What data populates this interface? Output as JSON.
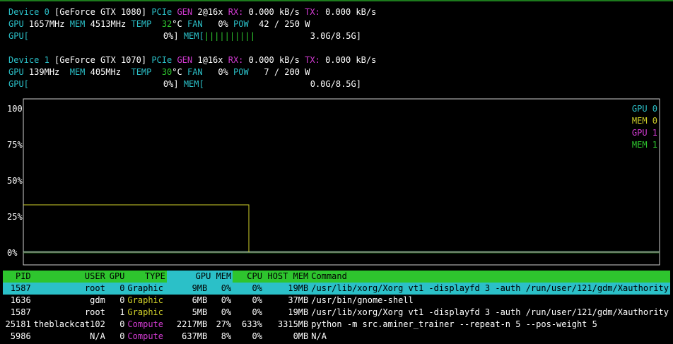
{
  "devices": [
    {
      "label": "Device 0",
      "model": "[GeForce GTX 1080]",
      "pcie_label": "PCIe",
      "gen_label": "GEN",
      "gen_value": "2@16x",
      "rx_label": "RX:",
      "rx_value": "0.000 kB/s",
      "tx_label": "TX:",
      "tx_value": "0.000 kB/s",
      "gpu_label": "GPU",
      "gpu_clock": "1657MHz",
      "mem_label": "MEM",
      "mem_clock": "4513MHz",
      "temp_label": "TEMP",
      "temp_value": "32",
      "temp_unit": "°C",
      "fan_label": "FAN",
      "fan_value": "0%",
      "pow_label": "POW",
      "pow_value": "42 / 250 W",
      "gpu_util_label": "GPU[",
      "gpu_util_value": "0%]",
      "gpu_util_fraction": 0,
      "mem_util_label": "MEM[",
      "mem_util_bars": "||||||||||",
      "mem_util_value": "3.0G/8.5G]",
      "mem_util_fraction": 0.35
    },
    {
      "label": "Device 1",
      "model": "[GeForce GTX 1070]",
      "pcie_label": "PCIe",
      "gen_label": "GEN",
      "gen_value": "1@16x",
      "rx_label": "RX:",
      "rx_value": "0.000 kB/s",
      "tx_label": "TX:",
      "tx_value": "0.000 kB/s",
      "gpu_label": "GPU",
      "gpu_clock": "139MHz",
      "mem_label": "MEM",
      "mem_clock": "405MHz",
      "temp_label": "TEMP",
      "temp_value": "30",
      "temp_unit": "°C",
      "fan_label": "FAN",
      "fan_value": "0%",
      "pow_label": "POW",
      "pow_value": "7 / 200 W",
      "gpu_util_label": "GPU[",
      "gpu_util_value": "0%]",
      "gpu_util_fraction": 0,
      "mem_util_label": "MEM[",
      "mem_util_bars": "",
      "mem_util_value": "0.0G/8.5G]",
      "mem_util_fraction": 0
    }
  ],
  "chart_data": {
    "type": "line",
    "ticks": [
      "100",
      "75%",
      "50%",
      "25%",
      "0%"
    ],
    "ylim": [
      0,
      100
    ],
    "grid": false,
    "legend_position": "top-right",
    "series": [
      {
        "name": "GPU 0",
        "color": "#2bc0c8",
        "values": [
          0,
          0
        ]
      },
      {
        "name": "MEM 0",
        "color": "#cfcf2a",
        "values": [
          33,
          33,
          0,
          0
        ]
      },
      {
        "name": "GPU 1",
        "color": "#d33bd3",
        "values": [
          0,
          0
        ]
      },
      {
        "name": "MEM 1",
        "color": "#2ec52e",
        "values": [
          0,
          0
        ]
      }
    ]
  },
  "process_table": {
    "headers": [
      "PID",
      "USER",
      "GPU",
      "TYPE",
      "GPU MEM",
      "CPU",
      "HOST MEM",
      "Command"
    ],
    "rows": [
      {
        "pid": "1587",
        "user": "root",
        "gpu": "0",
        "type": "Graphic",
        "type_color": "#cfcf2a",
        "gpu_mem": "9MB",
        "gpu_mem_pct": "0%",
        "cpu": "0%",
        "host_mem": "19MB",
        "command": "/usr/lib/xorg/Xorg vt1 -displayfd 3 -auth /run/user/121/gdm/Xauthority",
        "selected": true
      },
      {
        "pid": "1636",
        "user": "gdm",
        "gpu": "0",
        "type": "Graphic",
        "type_color": "#cfcf2a",
        "gpu_mem": "6MB",
        "gpu_mem_pct": "0%",
        "cpu": "0%",
        "host_mem": "37MB",
        "command": "/usr/bin/gnome-shell",
        "selected": false
      },
      {
        "pid": "1587",
        "user": "root",
        "gpu": "1",
        "type": "Graphic",
        "type_color": "#cfcf2a",
        "gpu_mem": "5MB",
        "gpu_mem_pct": "0%",
        "cpu": "0%",
        "host_mem": "19MB",
        "command": "/usr/lib/xorg/Xorg vt1 -displayfd 3 -auth /run/user/121/gdm/Xauthority",
        "selected": false
      },
      {
        "pid": "25181",
        "user": "theblackcat102",
        "gpu": "0",
        "type": "Compute",
        "type_color": "#d33bd3",
        "gpu_mem": "2217MB",
        "gpu_mem_pct": "27%",
        "cpu": "633%",
        "host_mem": "3315MB",
        "command": "python -m src.aminer_trainer --repeat-n 5 --pos-weight 5",
        "selected": false
      },
      {
        "pid": "5986",
        "user": "N/A",
        "gpu": "0",
        "type": "Compute",
        "type_color": "#d33bd3",
        "gpu_mem": "637MB",
        "gpu_mem_pct": "8%",
        "cpu": "0%",
        "host_mem": "0MB",
        "command": "N/A",
        "selected": false
      }
    ]
  }
}
